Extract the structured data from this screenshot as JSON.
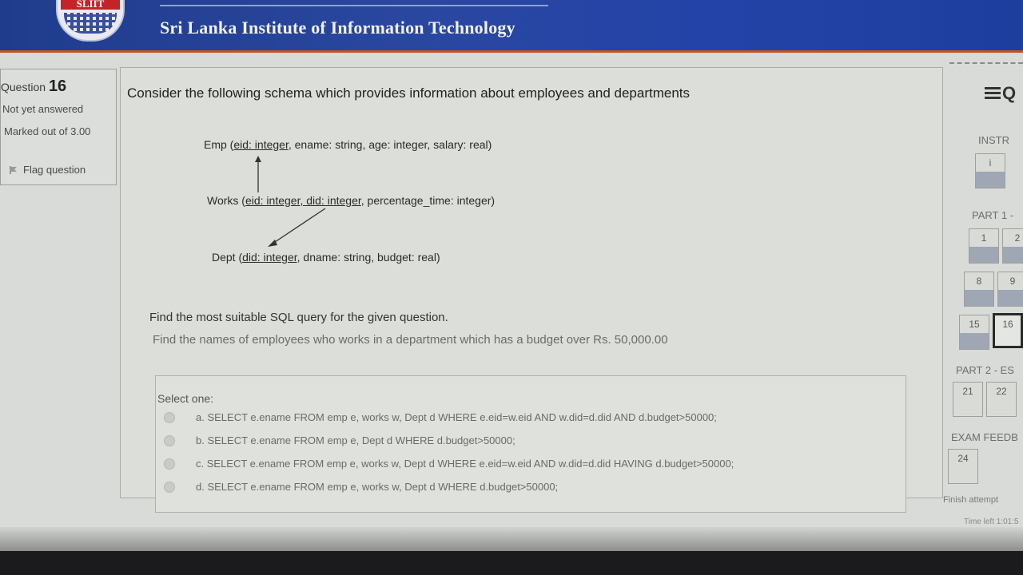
{
  "header": {
    "logo_text": "SLIIT",
    "institute_name": "Sri Lanka Institute of Information Technology"
  },
  "question_info": {
    "label": "Question",
    "number": "16",
    "state": "Not yet answered",
    "marked_out_of": "Marked out of 3.00",
    "flag_label": "Flag question"
  },
  "question": {
    "title": "Consider the following schema which provides information about employees and departments",
    "schema": {
      "emp": {
        "name": "Emp (",
        "key": "eid: integer",
        "rest": ", ename: string, age: integer, salary: real)"
      },
      "works": {
        "name": "Works (",
        "key": "eid: integer, did: integer",
        "rest": ", percentage_time: integer)"
      },
      "dept": {
        "name": "Dept (",
        "key": "did: integer",
        "rest": ", dname: string, budget: real)"
      }
    },
    "prompt": "Find the most suitable SQL query for the given question.",
    "task": "Find the names of employees who works in a department which has a budget over Rs. 50,000.00"
  },
  "answers": {
    "select_one": "Select one:",
    "options": [
      "a. SELECT e.ename FROM emp e, works w, Dept d WHERE e.eid=w.eid AND w.did=d.did AND d.budget>50000;",
      "b. SELECT e.ename FROM emp e, Dept d WHERE d.budget>50000;",
      "c. SELECT e.ename FROM emp e, works w, Dept d WHERE e.eid=w.eid AND w.did=d.did HAVING d.budget>50000;",
      "d. SELECT e.ename FROM emp e, works w, Dept d WHERE d.budget>50000;"
    ]
  },
  "quiz_nav": {
    "title": "Q",
    "instructions_label": "INSTR",
    "part1_label": "PART 1 -",
    "part2_label": "PART 2 - ES",
    "feedback_label": "EXAM FEEDB",
    "buttons": {
      "instr": "i",
      "b1": "1",
      "b2": "2",
      "b8": "8",
      "b9": "9",
      "b15": "15",
      "b16": "16",
      "b21": "21",
      "b22": "22",
      "b24": "24"
    },
    "finish": "Finish attempt",
    "time_left": "Time left 1:01:5"
  },
  "colors": {
    "header_blue": "#2343a8",
    "header_accent": "#c9531f",
    "logo_red": "#c2242a"
  }
}
